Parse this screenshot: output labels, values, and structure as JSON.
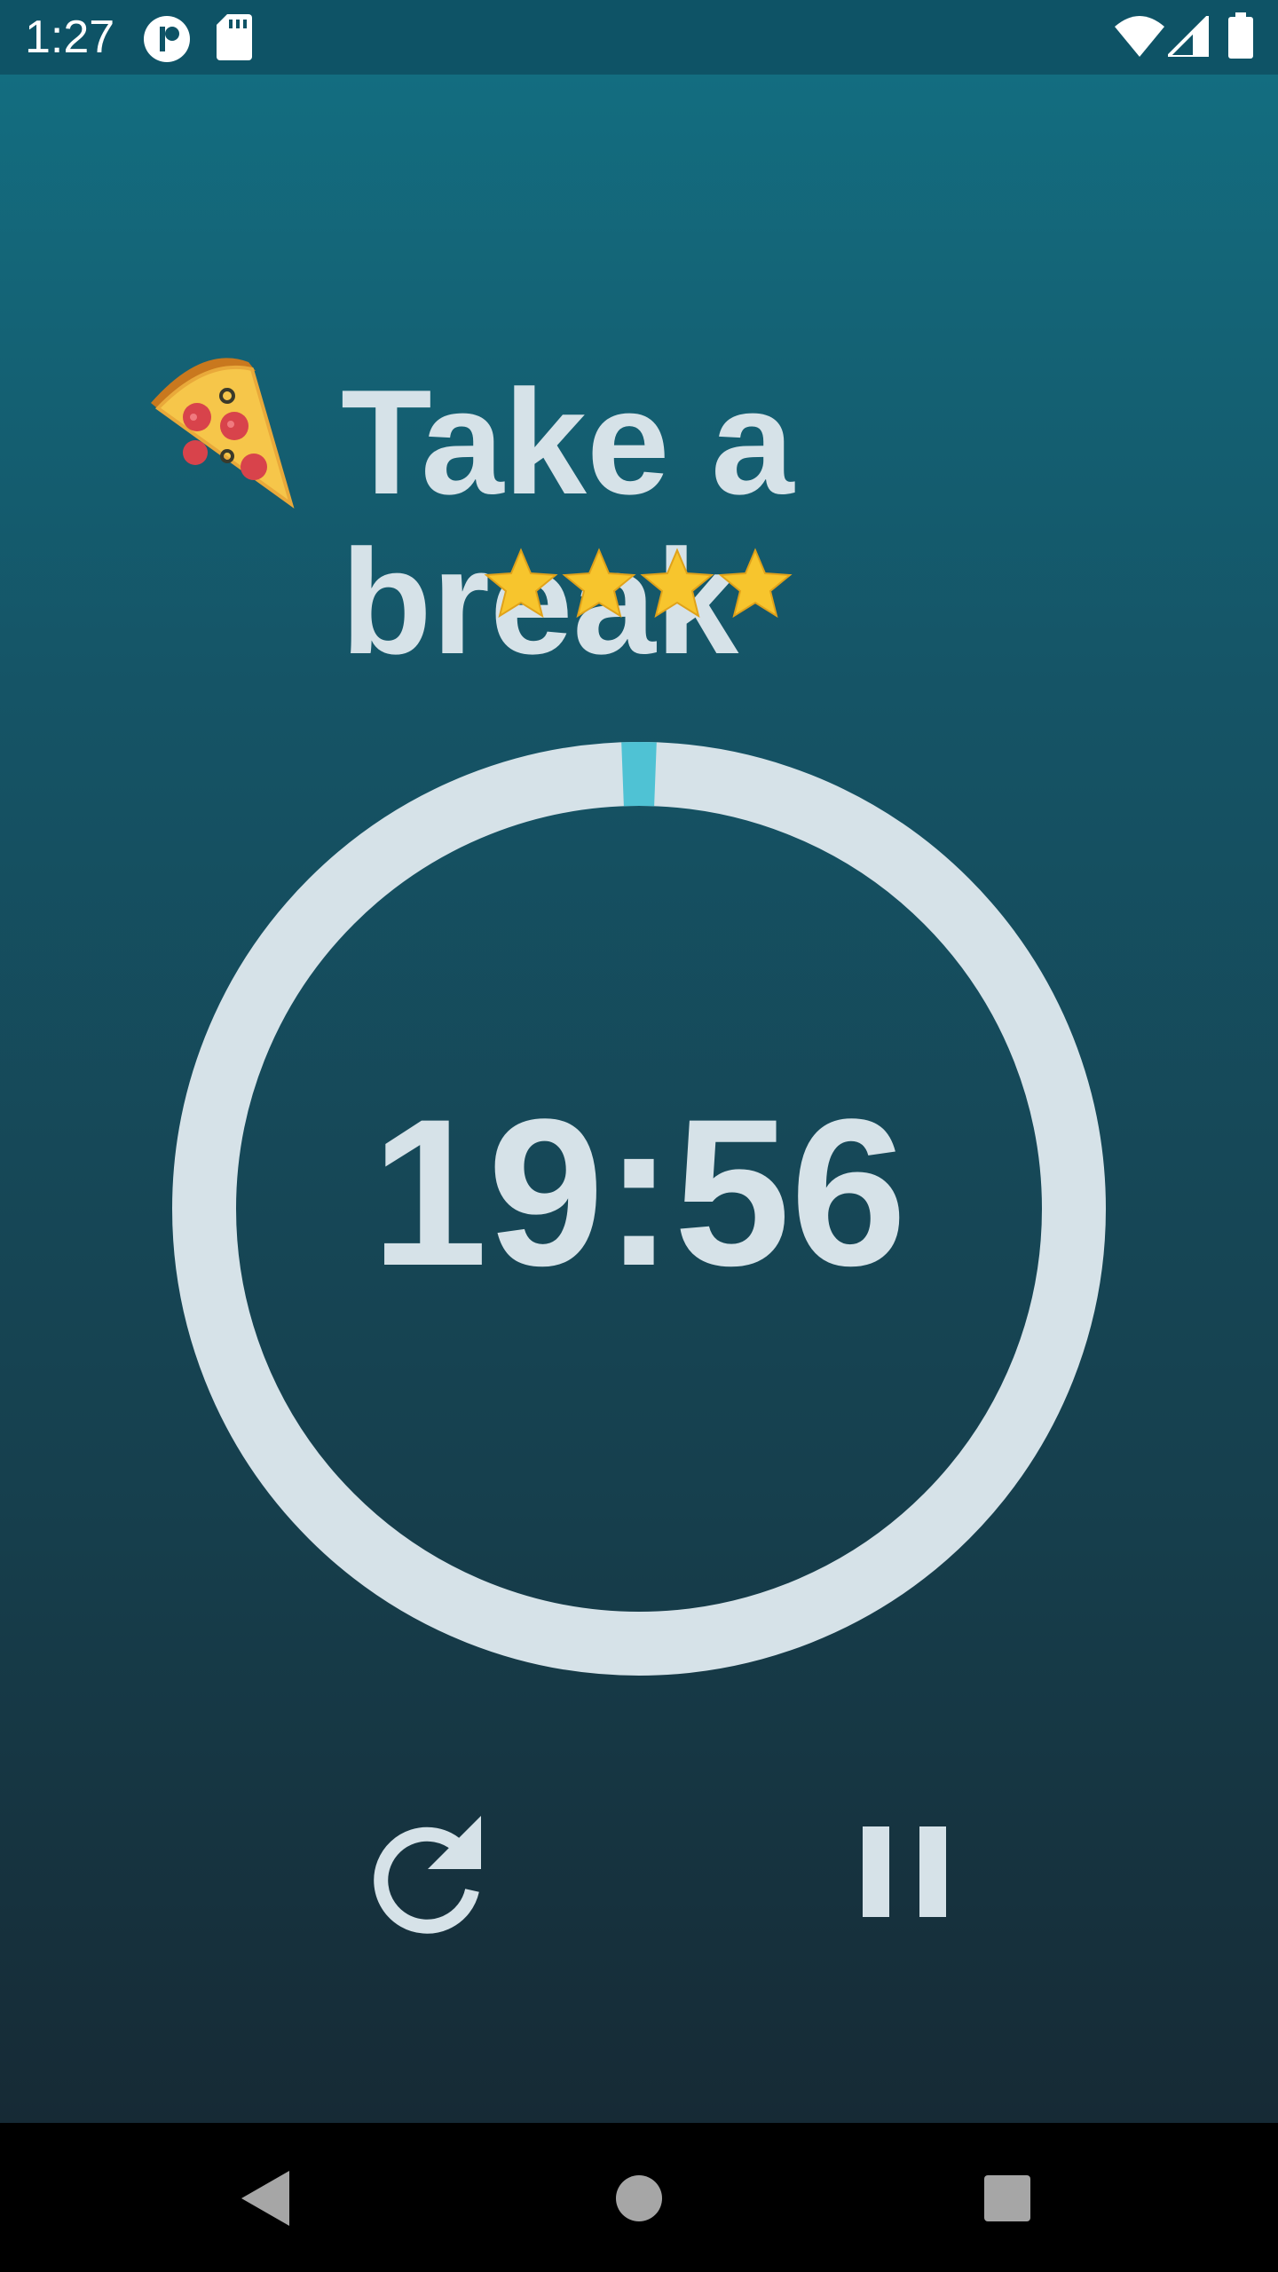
{
  "status_bar": {
    "time": "1:27",
    "left_icons": [
      "app-badge-icon",
      "sd-card-icon"
    ],
    "right_icons": [
      "wifi-icon",
      "cell-signal-icon",
      "battery-icon"
    ]
  },
  "header": {
    "emoji_icon": "pizza-icon",
    "title": "Take a break"
  },
  "rating": {
    "stars": 4,
    "star_color": "#f7c52d"
  },
  "timer": {
    "display": "19:56",
    "progress_fraction": 0.004,
    "ring_color": "#d6e2e8",
    "progress_color": "#4fc2d4"
  },
  "controls": {
    "reset_icon": "refresh-icon",
    "pause_icon": "pause-icon"
  },
  "nav_bar": {
    "buttons": [
      "back-icon",
      "home-icon",
      "recents-icon"
    ]
  },
  "colors": {
    "status_bar_bg": "#0e5366",
    "text_light": "#d6e2e8",
    "accent": "#4fc2d4"
  }
}
